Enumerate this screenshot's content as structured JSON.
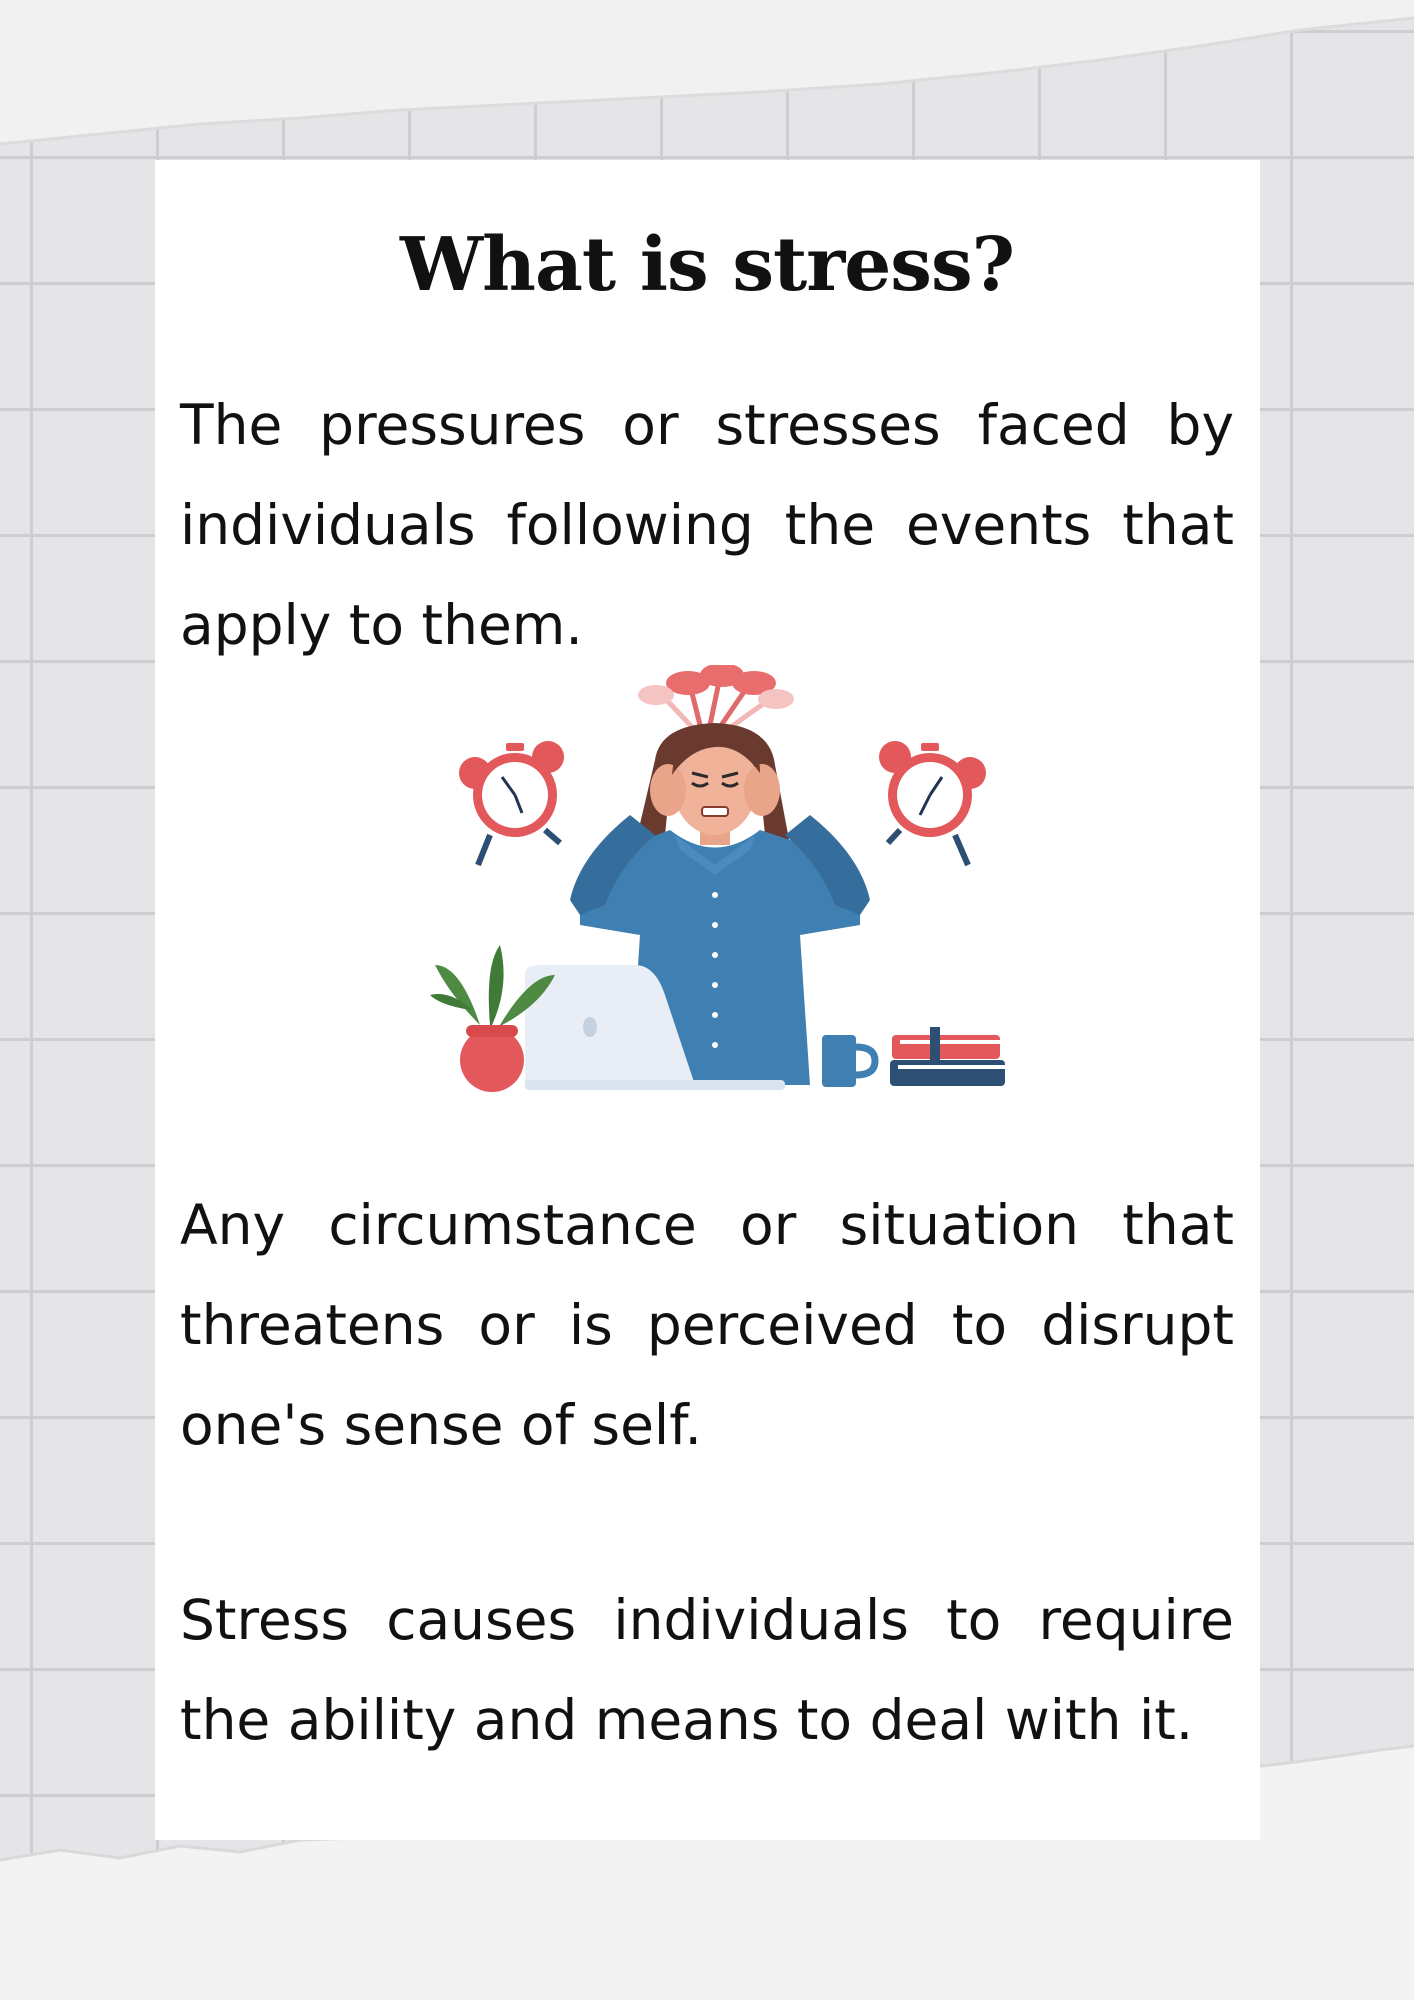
{
  "document": {
    "title": "What is stress?",
    "paragraphs": [
      "The pressures or stresses faced by individuals following the events that apply to them.",
      "Any circumstance or situation that threatens or is perceived to disrupt one's sense of self.",
      "Stress causes individuals to require the ability and means to deal with it."
    ]
  },
  "colors": {
    "background": "#e5e4e6",
    "grid_line": "#cfcdd0",
    "card": "#ffffff",
    "text": "#111111",
    "shirt_blue": "#3f7fb1",
    "clock_red": "#e3585a",
    "hair_brown": "#6b3a2e"
  },
  "illustration": {
    "name": "stressed-woman-with-alarm-clocks",
    "icons": [
      "alarm-clock-icon",
      "alarm-clock-icon",
      "plant-icon",
      "laptop-icon",
      "mug-icon",
      "books-icon"
    ]
  }
}
